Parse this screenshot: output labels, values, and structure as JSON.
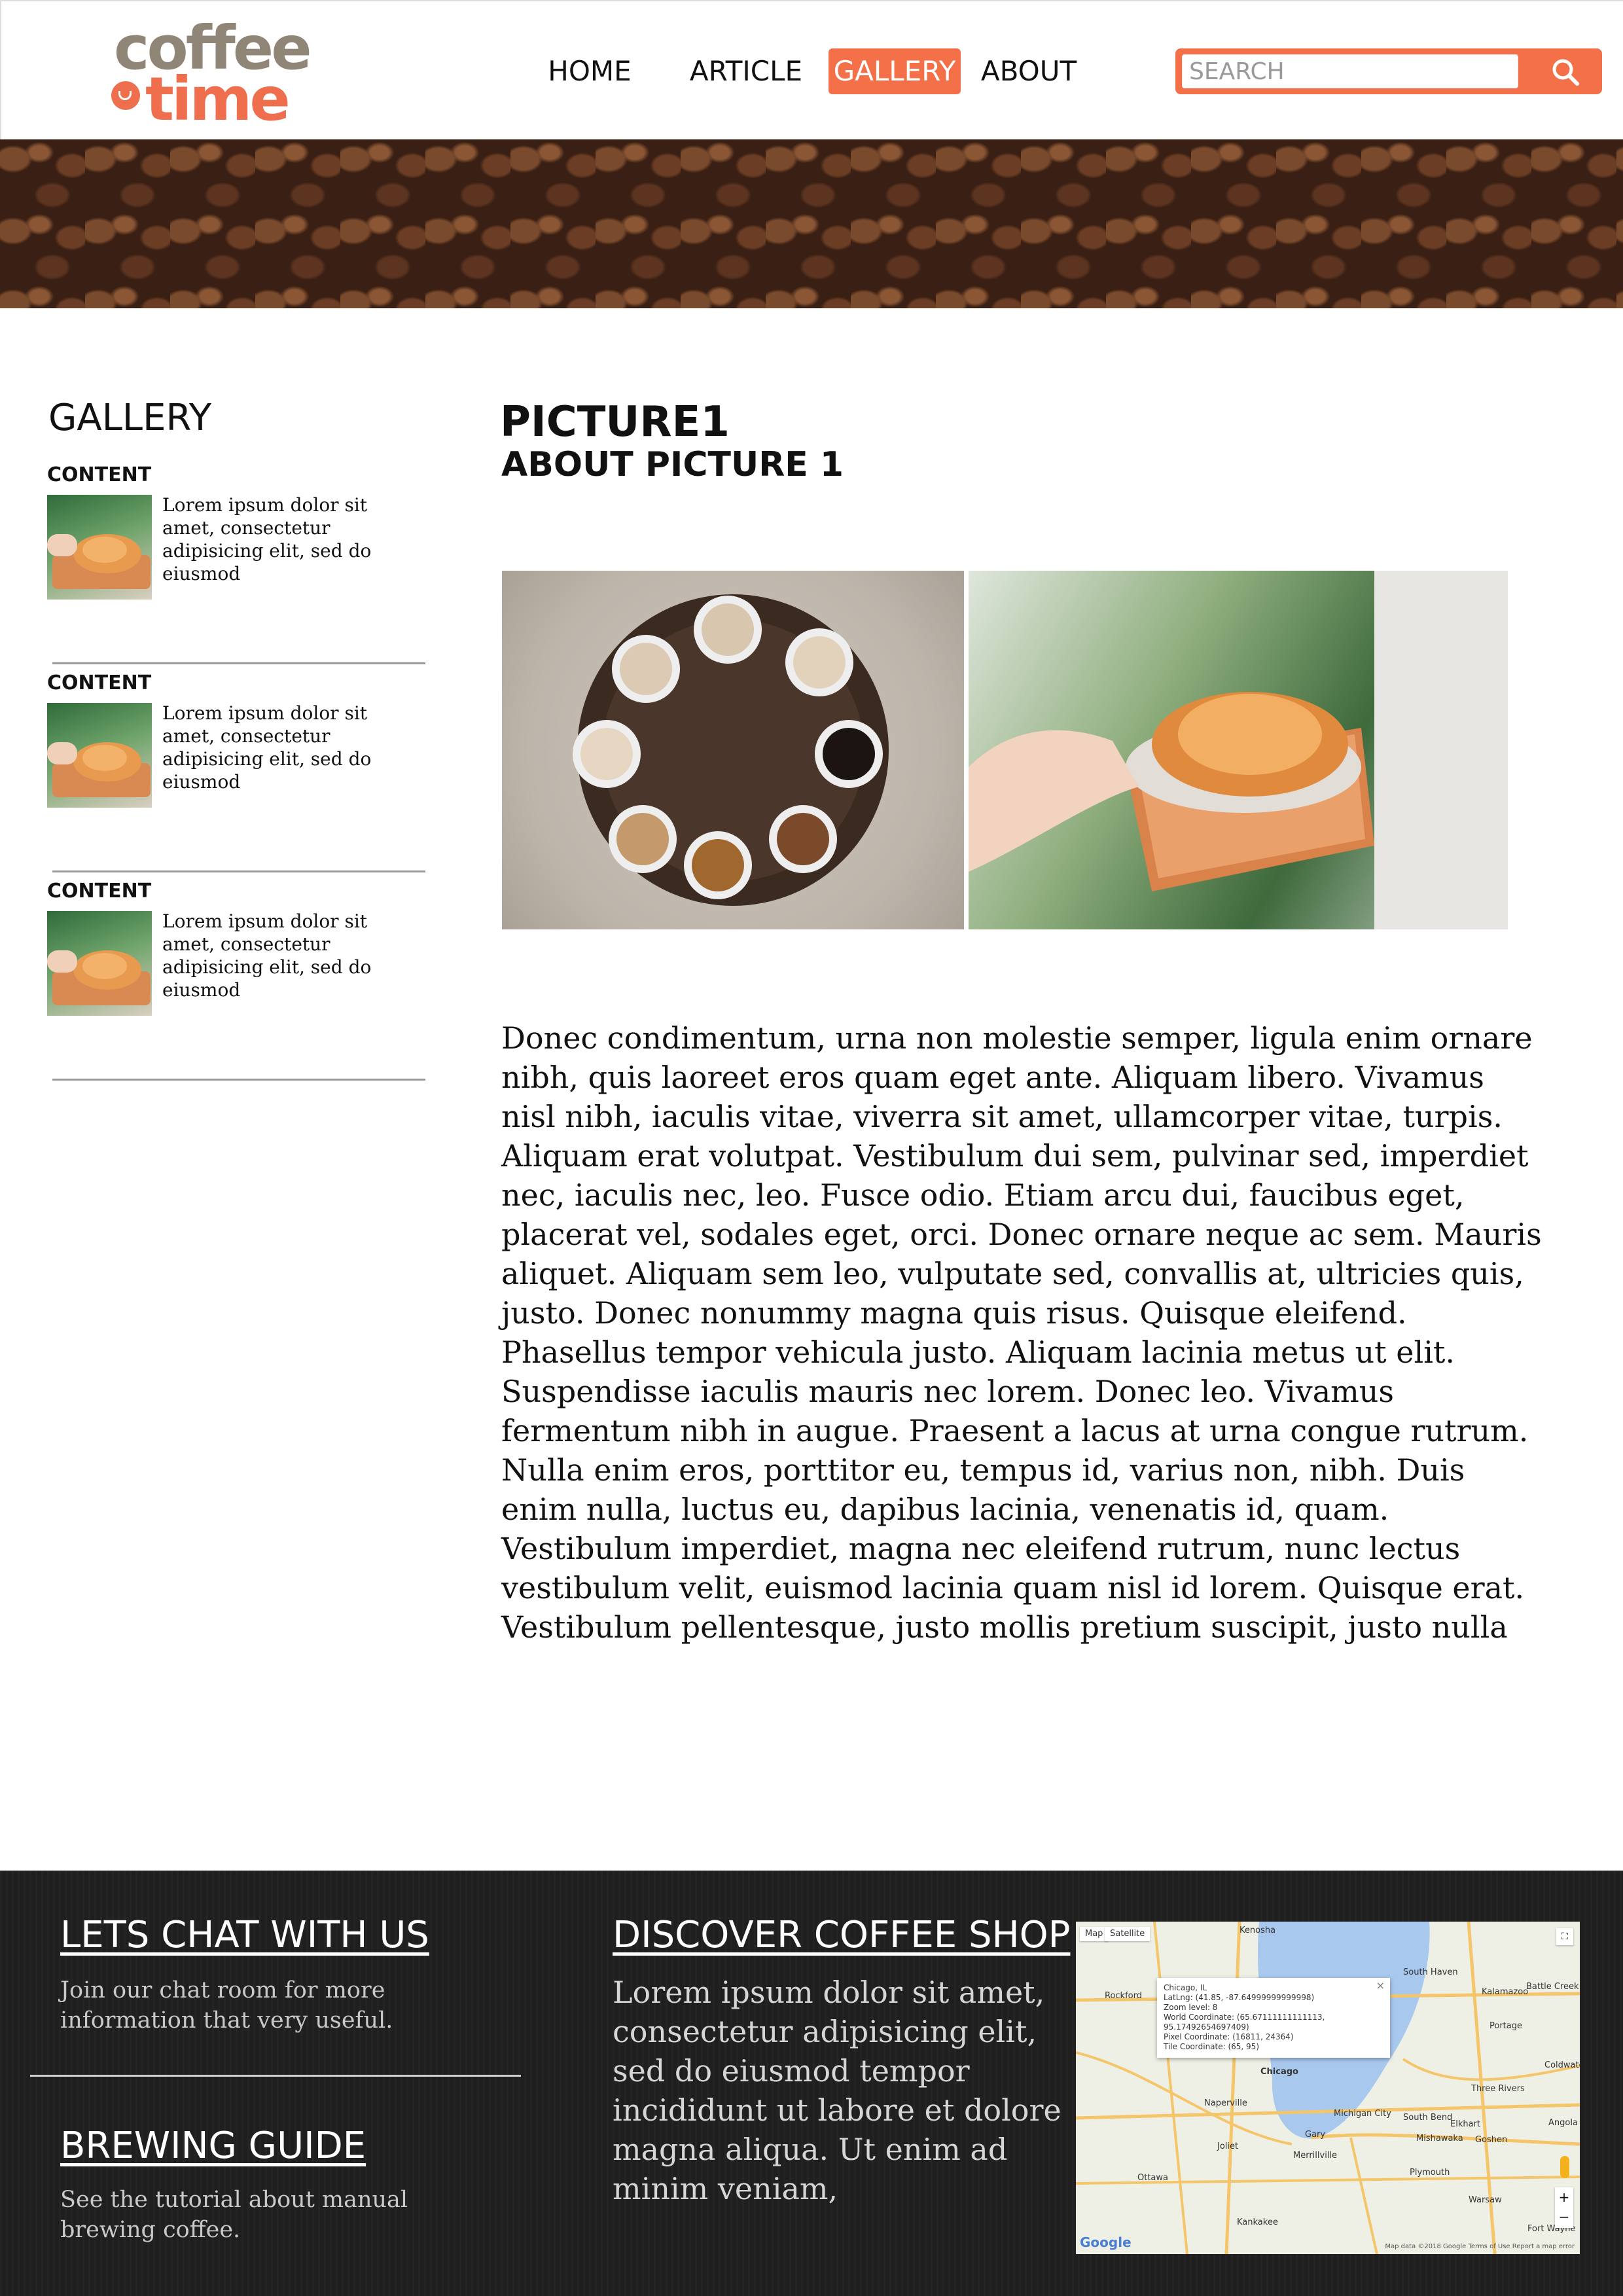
{
  "logo": {
    "line1": "coffee",
    "line2": "time"
  },
  "nav": {
    "items": [
      {
        "label": "HOME",
        "active": false
      },
      {
        "label": "ARTICLE",
        "active": false
      },
      {
        "label": "GALLERY",
        "active": true
      },
      {
        "label": "ABOUT",
        "active": false
      }
    ]
  },
  "search": {
    "placeholder": "SEARCH"
  },
  "colors": {
    "accent": "#f47048",
    "logo_grey": "#8f8677",
    "footer_bg": "#1f1f1f"
  },
  "sidebar": {
    "title": "GALLERY",
    "items": [
      {
        "caption": "CONTENT",
        "text": "Lorem ipsum dolor sit amet, consectetur adipisicing  elit, sed do eiusmod"
      },
      {
        "caption": "CONTENT",
        "text": "Lorem ipsum dolor sit amet, consectetur adipisicing  elit, sed do eiusmod"
      },
      {
        "caption": "CONTENT",
        "text": "Lorem ipsum dolor sit amet, consectetur adipisicing  elit, sed do eiusmod"
      }
    ]
  },
  "main": {
    "title": "PICTURE1",
    "subtitle": "ABOUT PICTURE 1",
    "body": "Donec condimentum, urna non molestie semper, ligula enim ornare nibh, quis laoreet eros quam eget ante. Aliquam libero. Vivamus nisl nibh, iaculis vitae, viverra sit amet, ullamcorper vitae, turpis. Aliquam erat volutpat. Vestibulum dui sem, pulvinar sed, imperdiet nec, iaculis nec, leo. Fusce odio. Etiam arcu dui, faucibus eget, placerat vel, sodales eget, orci. Donec ornare neque ac sem. Mauris aliquet. Aliquam sem leo, vulputate sed, convallis at, ultricies quis, justo. Donec nonummy magna quis risus. Quisque eleifend. Phasellus tempor vehicula justo. Aliquam lacinia metus ut elit. Suspendisse iaculis mauris nec lorem. Donec leo. Vivamus fermentum nibh in augue. Praesent a lacus at urna congue rutrum. Nulla enim eros, porttitor eu, tempus id, varius non, nibh. Duis enim nulla, luctus eu, dapibus lacinia, venenatis id, quam. Vestibulum imperdiet, magna nec eleifend rutrum, nunc lectus vestibulum velit, euismod lacinia quam nisl id lorem. Quisque erat. Vestibulum pellentesque, justo mollis pretium suscipit, justo nulla"
  },
  "footer": {
    "chat": {
      "heading": "LETS CHAT WITH US",
      "text": "Join our chat room for more information that very useful."
    },
    "brewing": {
      "heading": "BREWING GUIDE",
      "text": "See the tutorial about manual brewing coffee."
    },
    "discover": {
      "heading": "DISCOVER COFFEE SHOP",
      "text": "Lorem ipsum dolor sit amet, consectetur adipisicing elit, sed do eiusmod tempor incididunt ut labore et dolore magna aliqua. Ut enim ad minim veniam,"
    }
  },
  "map": {
    "tabs": [
      "Map",
      "Satellite"
    ],
    "popup_lines": [
      "Chicago, IL",
      "LatLng: (41.85, -87.64999999999998)",
      "Zoom level: 8",
      "World Coordinate: (65.67111111111113, 95.17492654697409)",
      "Pixel Coordinate: (16811, 24364)",
      "Tile Coordinate: (65, 95)"
    ],
    "cities": [
      "Kenosha",
      "Rockford",
      "Chicago",
      "Naperville",
      "Joliet",
      "Gary",
      "Michigan City",
      "South Bend",
      "Elkhart",
      "Kalamazoo",
      "Battle Creek",
      "Portage",
      "South Haven",
      "Three Rivers",
      "Mishawaka",
      "Goshen",
      "Merrillville",
      "Kankakee",
      "Ottawa",
      "Fort Wayne",
      "Warsaw",
      "Angola",
      "Coldwater",
      "Plymouth"
    ],
    "footer_text": "Map data ©2018 Google   Terms of Use   Report a map error",
    "brand": "Google",
    "close_symbol": "×",
    "zoom_in": "+",
    "zoom_out": "−"
  }
}
